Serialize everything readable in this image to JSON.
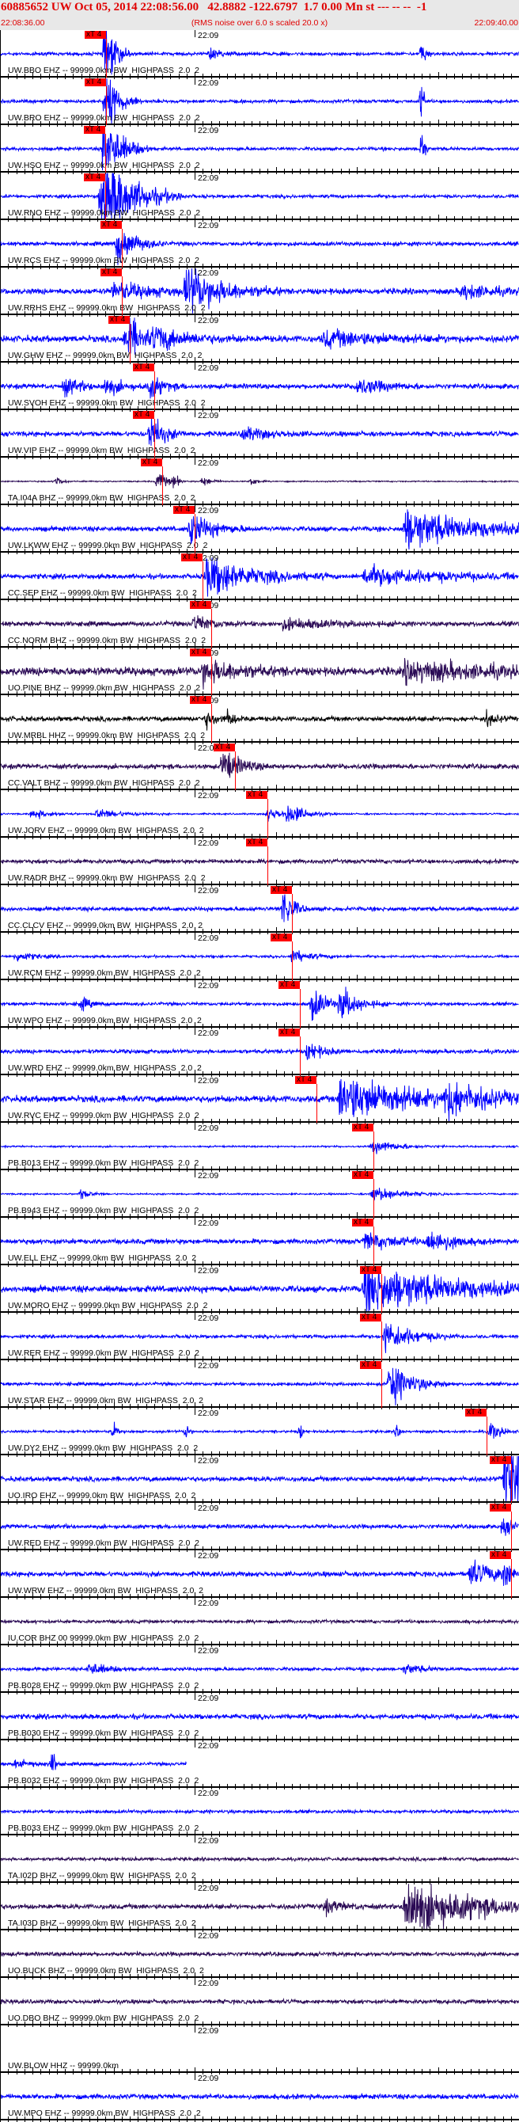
{
  "header": {
    "title": "60885652 UW Oct 05, 2014 22:08:56.00   42.8882 -122.6797  1.7 0.00 Mn st --- -- --  -1",
    "start_time": "22:08:36.00",
    "note": "(RMS noise over 6.0 s scaled 20.0 x)",
    "end_time": "22:09:40.00"
  },
  "window_seconds": 64,
  "minute_mark": {
    "label": "22:09",
    "t": 24
  },
  "pick_label": "xT 4",
  "colors": {
    "blue": "#0000ff",
    "purple": "#2a0a55",
    "black": "#000000",
    "pick": "#ff0000",
    "header_text": "#e00000"
  },
  "traces": [
    {
      "label": "UW.BBO EHZ -- 99999.0km BW  HIGHPASS  2.0  2",
      "color": "blue",
      "pick": 13.1,
      "noise": 2,
      "events": [
        [
          13,
          40,
          1.2
        ],
        [
          26,
          8,
          1
        ],
        [
          52,
          15,
          0.5
        ]
      ]
    },
    {
      "label": "UW.BRO EHZ -- 99999.0km BW  HIGHPASS  2.0  2",
      "color": "blue",
      "pick": 13.1,
      "noise": 2,
      "events": [
        [
          13,
          40,
          1.5
        ],
        [
          52,
          25,
          0.3
        ]
      ]
    },
    {
      "label": "UW.HSO EHZ -- 99999.0km BW  HIGHPASS  2.0  2",
      "color": "blue",
      "pick": 13.0,
      "noise": 2,
      "events": [
        [
          12.8,
          45,
          2
        ],
        [
          52,
          30,
          0.3
        ]
      ]
    },
    {
      "label": "UW.RNO EHZ -- 99999.0km BW  HIGHPASS  2.0  2",
      "color": "blue",
      "pick": 13.0,
      "noise": 2,
      "events": [
        [
          12.5,
          60,
          3.5
        ]
      ]
    },
    {
      "label": "UW.RCS EHZ -- 99999.0km BW  HIGHPASS  2.0  2",
      "color": "blue",
      "pick": 15.0,
      "noise": 2.5,
      "events": [
        [
          14.5,
          25,
          2
        ]
      ]
    },
    {
      "label": "UW.RRHS EHZ -- 99999.0km BW  HIGHPASS  2.0  2",
      "color": "blue",
      "pick": 15.0,
      "noise": 3.5,
      "events": [
        [
          14,
          10,
          5
        ],
        [
          23,
          30,
          4
        ],
        [
          57,
          10,
          3
        ]
      ]
    },
    {
      "label": "UW.GHW EHZ -- 99999.0km BW  HIGHPASS  2.0  2",
      "color": "blue",
      "pick": 16.0,
      "noise": 4,
      "events": [
        [
          15.5,
          30,
          2
        ],
        [
          19,
          12,
          4
        ],
        [
          40,
          10,
          6
        ]
      ]
    },
    {
      "label": "UW.SVOH EHZ -- 99999.0km BW  HIGHPASS  2.0  2",
      "color": "blue",
      "pick": 19.0,
      "noise": 3,
      "events": [
        [
          8,
          10,
          2
        ],
        [
          13,
          10,
          2
        ],
        [
          18.5,
          15,
          1.5
        ],
        [
          44,
          10,
          3
        ]
      ]
    },
    {
      "label": "UW.VIP EHZ -- 99999.0km BW  HIGHPASS  2.0  2",
      "color": "blue",
      "pick": 19.0,
      "noise": 3,
      "events": [
        [
          18.5,
          25,
          1.5
        ],
        [
          30,
          8,
          3
        ]
      ]
    },
    {
      "label": "TA.I04A BHZ -- 99999.0km BW  HIGHPASS  2.0  2",
      "color": "purple",
      "pick": 20.0,
      "noise": 0.8,
      "events": [
        [
          7,
          8,
          0.5
        ],
        [
          19.5,
          14,
          1
        ],
        [
          21.5,
          8,
          0.5
        ],
        [
          25,
          6,
          1
        ],
        [
          31,
          6,
          0.6
        ]
      ]
    },
    {
      "label": "UW.LKWW EHZ -- 99999.0km BW  HIGHPASS  2.0  2",
      "color": "blue",
      "pick": 24.0,
      "noise": 3,
      "events": [
        [
          23.5,
          20,
          2.5
        ],
        [
          50,
          25,
          8
        ]
      ]
    },
    {
      "label": "CC.SEP EHZ -- 99999.0km BW  HIGHPASS  2.0  2",
      "color": "blue",
      "pick": 25.0,
      "noise": 3,
      "events": [
        [
          25.5,
          25,
          5
        ],
        [
          45,
          12,
          8
        ]
      ]
    },
    {
      "label": "CC.NORM BHZ -- 99999.0km BW  HIGHPASS  2.0  2",
      "color": "purple",
      "pick": 26.0,
      "noise": 3,
      "events": [
        [
          24,
          10,
          2
        ],
        [
          35,
          6,
          5
        ]
      ]
    },
    {
      "label": "UO.PINE BHZ -- 99999.0km BW  HIGHPASS  2.0  2",
      "color": "purple",
      "pick": 26.0,
      "noise": 5,
      "events": [
        [
          25,
          15,
          4
        ],
        [
          50,
          12,
          10
        ]
      ]
    },
    {
      "label": "UW.MRBL HHZ -- 99999.0km BW  HIGHPASS  2.0  2",
      "color": "black",
      "pick": 26.0,
      "noise": 3,
      "events": [
        [
          25.5,
          10,
          1
        ],
        [
          28,
          8,
          1
        ],
        [
          60,
          8,
          1
        ]
      ]
    },
    {
      "label": "CC.VALT BHZ -- 99999.0km BW  HIGHPASS  2.0  2",
      "color": "purple",
      "pick": 29.0,
      "noise": 3,
      "events": [
        [
          27.5,
          20,
          2
        ]
      ]
    },
    {
      "label": "UW.JORV EHZ -- 99999.0km BW  HIGHPASS  2.0  2",
      "color": "blue",
      "pick": 33.0,
      "noise": 1,
      "events": [
        [
          4,
          6,
          2
        ],
        [
          12,
          6,
          3
        ],
        [
          33,
          8,
          2
        ],
        [
          35.5,
          12,
          2
        ]
      ]
    },
    {
      "label": "UW.RADR BHZ -- 99999.0km BW  HIGHPASS  2.0  2",
      "color": "purple",
      "pick": 33.0,
      "noise": 2.5,
      "events": []
    },
    {
      "label": "CC.CLCV EHZ -- 99999.0km BW  HIGHPASS  2.0  2",
      "color": "blue",
      "pick": 36.0,
      "noise": 2.5,
      "events": [
        [
          35,
          30,
          1
        ]
      ]
    },
    {
      "label": "UW.RCM EHZ -- 99999.0km BW  HIGHPASS  2.0  2",
      "color": "blue",
      "pick": 36.0,
      "noise": 1.5,
      "events": [
        [
          2,
          6,
          2
        ],
        [
          36,
          8,
          2
        ]
      ]
    },
    {
      "label": "UW.WPO EHZ -- 99999.0km BW  HIGHPASS  2.0  2",
      "color": "blue",
      "pick": 37.0,
      "noise": 2,
      "events": [
        [
          10,
          8,
          1
        ],
        [
          38.5,
          22,
          1.5
        ],
        [
          42,
          20,
          2
        ]
      ]
    },
    {
      "label": "UW.WRD EHZ -- 99999.0km BW  HIGHPASS  2.0  2",
      "color": "blue",
      "pick": 37.0,
      "noise": 2.5,
      "events": [
        [
          38,
          12,
          1.5
        ]
      ]
    },
    {
      "label": "UW.RVC EHZ -- 99999.0km BW  HIGHPASS  2.0  2",
      "color": "blue",
      "pick": 39.0,
      "noise": 4,
      "events": [
        [
          42,
          30,
          8
        ],
        [
          55,
          20,
          4
        ]
      ]
    },
    {
      "label": "PB.B013 EHZ -- 99999.0km BW  HIGHPASS  2.0  2",
      "color": "blue",
      "pick": 46.0,
      "noise": 1,
      "events": [
        [
          46,
          8,
          3
        ]
      ]
    },
    {
      "label": "PB.B943 EHZ -- 99999.0km BW  HIGHPASS  2.0  2",
      "color": "blue",
      "pick": 46.0,
      "noise": 1,
      "events": [
        [
          10,
          6,
          1
        ],
        [
          46,
          10,
          3
        ]
      ]
    },
    {
      "label": "UW.ELL EHZ -- 99999.0km BW  HIGHPASS  2.0  2",
      "color": "blue",
      "pick": 46.0,
      "noise": 3,
      "events": [
        [
          45,
          10,
          4
        ],
        [
          53,
          15,
          2.5
        ]
      ]
    },
    {
      "label": "UW.MORO EHZ -- 99999.0km BW  HIGHPASS  2.0  2",
      "color": "blue",
      "pick": 47.0,
      "noise": 4,
      "events": [
        [
          45,
          30,
          10
        ]
      ]
    },
    {
      "label": "UW.RER EHZ -- 99999.0km BW  HIGHPASS  2.0  2",
      "color": "blue",
      "pick": 47.0,
      "noise": 2,
      "events": [
        [
          47.5,
          20,
          3
        ]
      ]
    },
    {
      "label": "UW.STAR EHZ -- 99999.0km BW  HIGHPASS  2.0  2",
      "color": "blue",
      "pick": 47.0,
      "noise": 2,
      "events": [
        [
          48,
          28,
          2.5
        ]
      ]
    },
    {
      "label": "UW.DY2 EHZ -- 99999.0km BW  HIGHPASS  2.0  2",
      "color": "blue",
      "pick": 60.0,
      "noise": 1.5,
      "events": [
        [
          14,
          12,
          0.3
        ],
        [
          23,
          12,
          0.3
        ],
        [
          37,
          10,
          0.3
        ],
        [
          49,
          10,
          0.3
        ],
        [
          60.5,
          12,
          0.3
        ],
        [
          61,
          8,
          1
        ]
      ]
    },
    {
      "label": "UO.IRO EHZ -- 99999.0km BW  HIGHPASS  2.0  2",
      "color": "blue",
      "pick": 63.0,
      "noise": 3,
      "events": [
        [
          62.3,
          60,
          3
        ]
      ]
    },
    {
      "label": "UW.RED EHZ -- 99999.0km BW  HIGHPASS  2.0  2",
      "color": "blue",
      "pick": 63.0,
      "noise": 2.5,
      "events": [
        [
          62,
          10,
          1.5
        ]
      ]
    },
    {
      "label": "UW.WRW EHZ -- 99999.0km BW  HIGHPASS  2.0  2",
      "color": "blue",
      "pick": 63.0,
      "noise": 3,
      "events": [
        [
          58,
          15,
          3
        ],
        [
          62,
          15,
          1
        ]
      ]
    },
    {
      "label": "IU.COR BHZ 00 99999.0km BW  HIGHPASS  2.0  2",
      "color": "purple",
      "pick": null,
      "noise": 2,
      "events": []
    },
    {
      "label": "PB.B028 EHZ -- 99999.0km BW  HIGHPASS  2.0  2",
      "color": "blue",
      "pick": null,
      "noise": 2,
      "events": [
        [
          11,
          8,
          2
        ],
        [
          50,
          6,
          2
        ]
      ]
    },
    {
      "label": "PB.B030 EHZ -- 99999.0km BW  HIGHPASS  2.0  2",
      "color": "blue",
      "pick": null,
      "noise": 3,
      "events": []
    },
    {
      "label": "PB.B032 EHZ -- 99999.0km BW  HIGHPASS  2.0  2",
      "color": "blue",
      "pick": null,
      "noise": 2,
      "end": 23,
      "events": [
        [
          6.5,
          14,
          0.4
        ],
        [
          2,
          5,
          2
        ]
      ]
    },
    {
      "label": "PB.B033 EHZ -- 99999.0km BW  HIGHPASS  2.0  2",
      "color": "blue",
      "pick": null,
      "noise": 2,
      "events": []
    },
    {
      "label": "TA.I02D BHZ -- 99999.0km BW  HIGHPASS  2.0  2",
      "color": "purple",
      "pick": null,
      "noise": 2,
      "events": []
    },
    {
      "label": "TA.I03D BHZ -- 99999.0km BW  HIGHPASS  2.0  2",
      "color": "purple",
      "pick": null,
      "noise": 3,
      "events": [
        [
          50,
          40,
          7
        ],
        [
          40,
          8,
          2
        ]
      ]
    },
    {
      "label": "UO.BUCK BHZ -- 99999.0km BW  HIGHPASS  2.0  2",
      "color": "purple",
      "pick": null,
      "noise": 2.5,
      "events": []
    },
    {
      "label": "UO.DBO BHZ -- 99999.0km BW  HIGHPASS  2.0  2",
      "color": "purple",
      "pick": null,
      "noise": 2.5,
      "events": []
    },
    {
      "label": "UW.BLOW HHZ -- 99999.0km",
      "color": "blue",
      "pick": null,
      "noise": 0,
      "end": 0,
      "events": []
    },
    {
      "label": "UW.MPO EHZ -- 99999.0km BW  HIGHPASS  2.0  2",
      "color": "blue",
      "pick": null,
      "noise": 3,
      "events": []
    }
  ]
}
